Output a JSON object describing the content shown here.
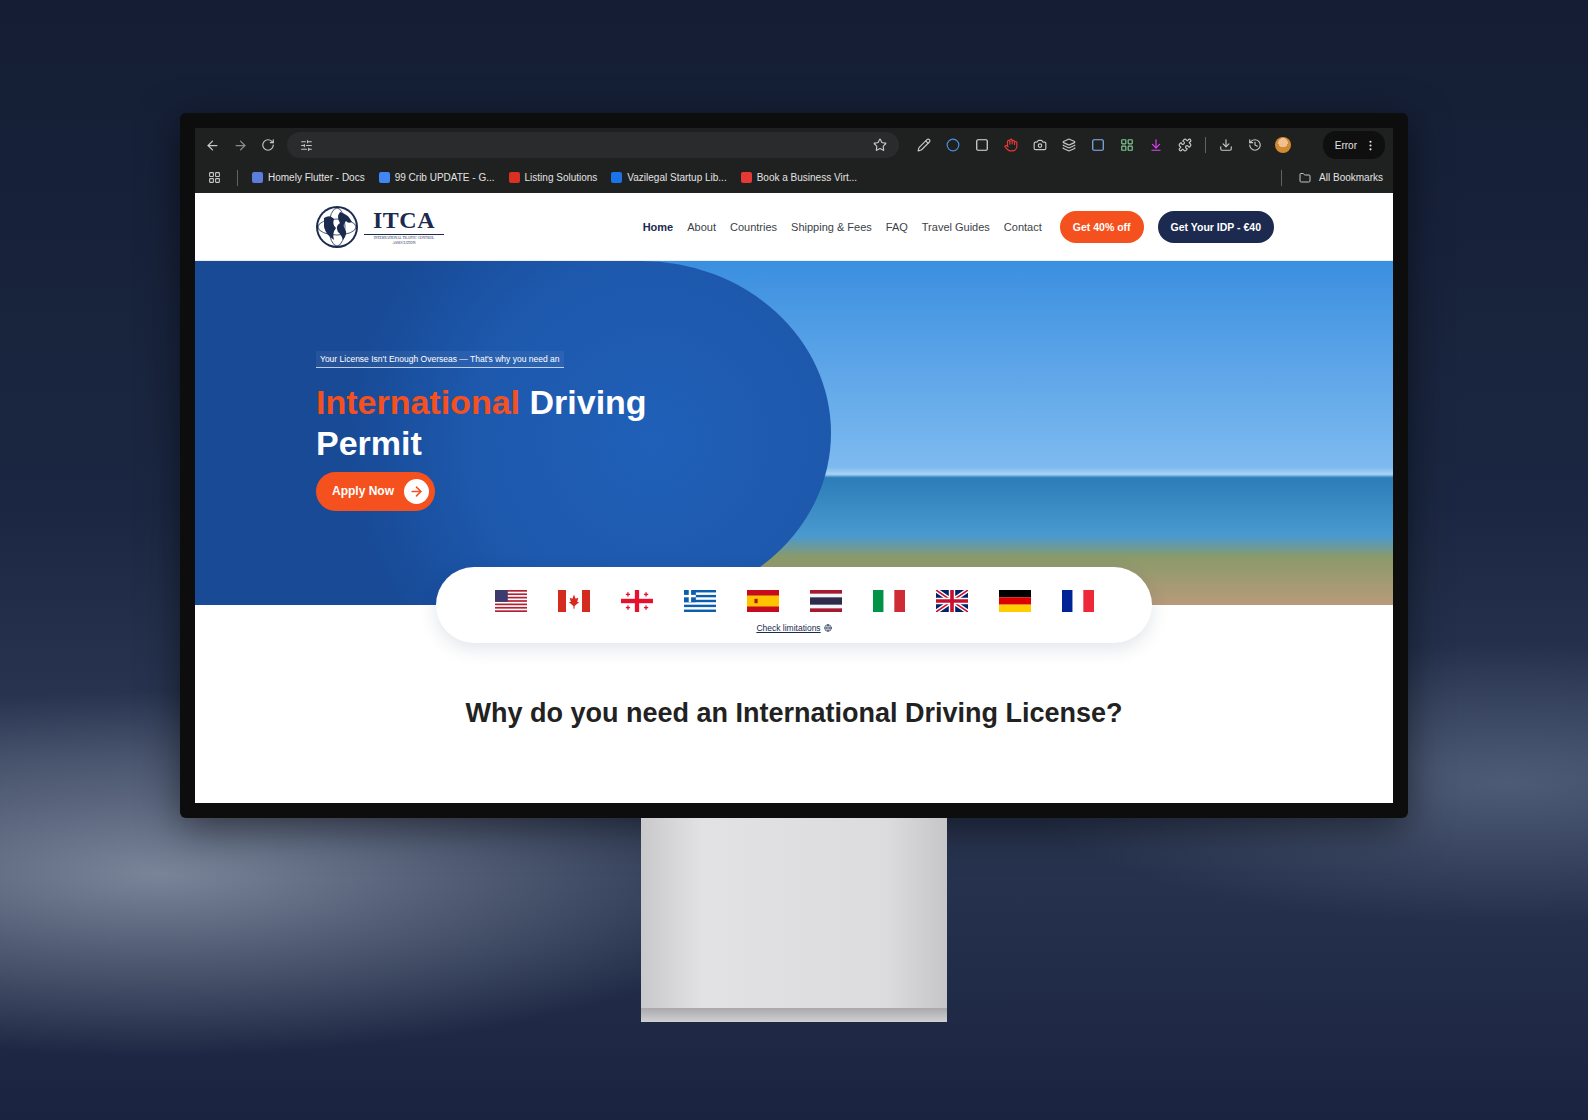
{
  "browser": {
    "bookmarks": [
      "Homely Flutter - Docs",
      "99 Crib UPDATE - G...",
      "Listing Solutions",
      "Vazilegal Startup Lib...",
      "Book a Business Virt..."
    ],
    "all_bookmarks": "All Bookmarks",
    "profile": "Error"
  },
  "site": {
    "logo": {
      "name": "ITCA",
      "subtitle": "INTERNATIONAL TRAFFIC CONTROL ASSOCIATION"
    },
    "nav": [
      {
        "label": "Home",
        "selected": true
      },
      {
        "label": "About",
        "selected": false
      },
      {
        "label": "Countries",
        "selected": false
      },
      {
        "label": "Shipping & Fees",
        "selected": false
      },
      {
        "label": "FAQ",
        "selected": false
      },
      {
        "label": "Travel Guides",
        "selected": false
      },
      {
        "label": "Contact",
        "selected": false
      }
    ],
    "promo_button": "Get 40% off",
    "cta_button": "Get Your IDP - €40"
  },
  "hero": {
    "tagline": "Your License Isn't Enough Overseas — That's why you need an",
    "title_highlight": "International",
    "title_rest": "Driving Permit",
    "apply_button": "Apply Now"
  },
  "flags": [
    {
      "kind": "us"
    },
    {
      "kind": "ca"
    },
    {
      "kind": "ge"
    },
    {
      "kind": "gr"
    },
    {
      "kind": "es"
    },
    {
      "kind": "th"
    },
    {
      "kind": "it"
    },
    {
      "kind": "gb"
    },
    {
      "kind": "de"
    },
    {
      "kind": "fr"
    }
  ],
  "check_limitations": "Check limitations",
  "section_title": "Why do you need an International Driving License?"
}
